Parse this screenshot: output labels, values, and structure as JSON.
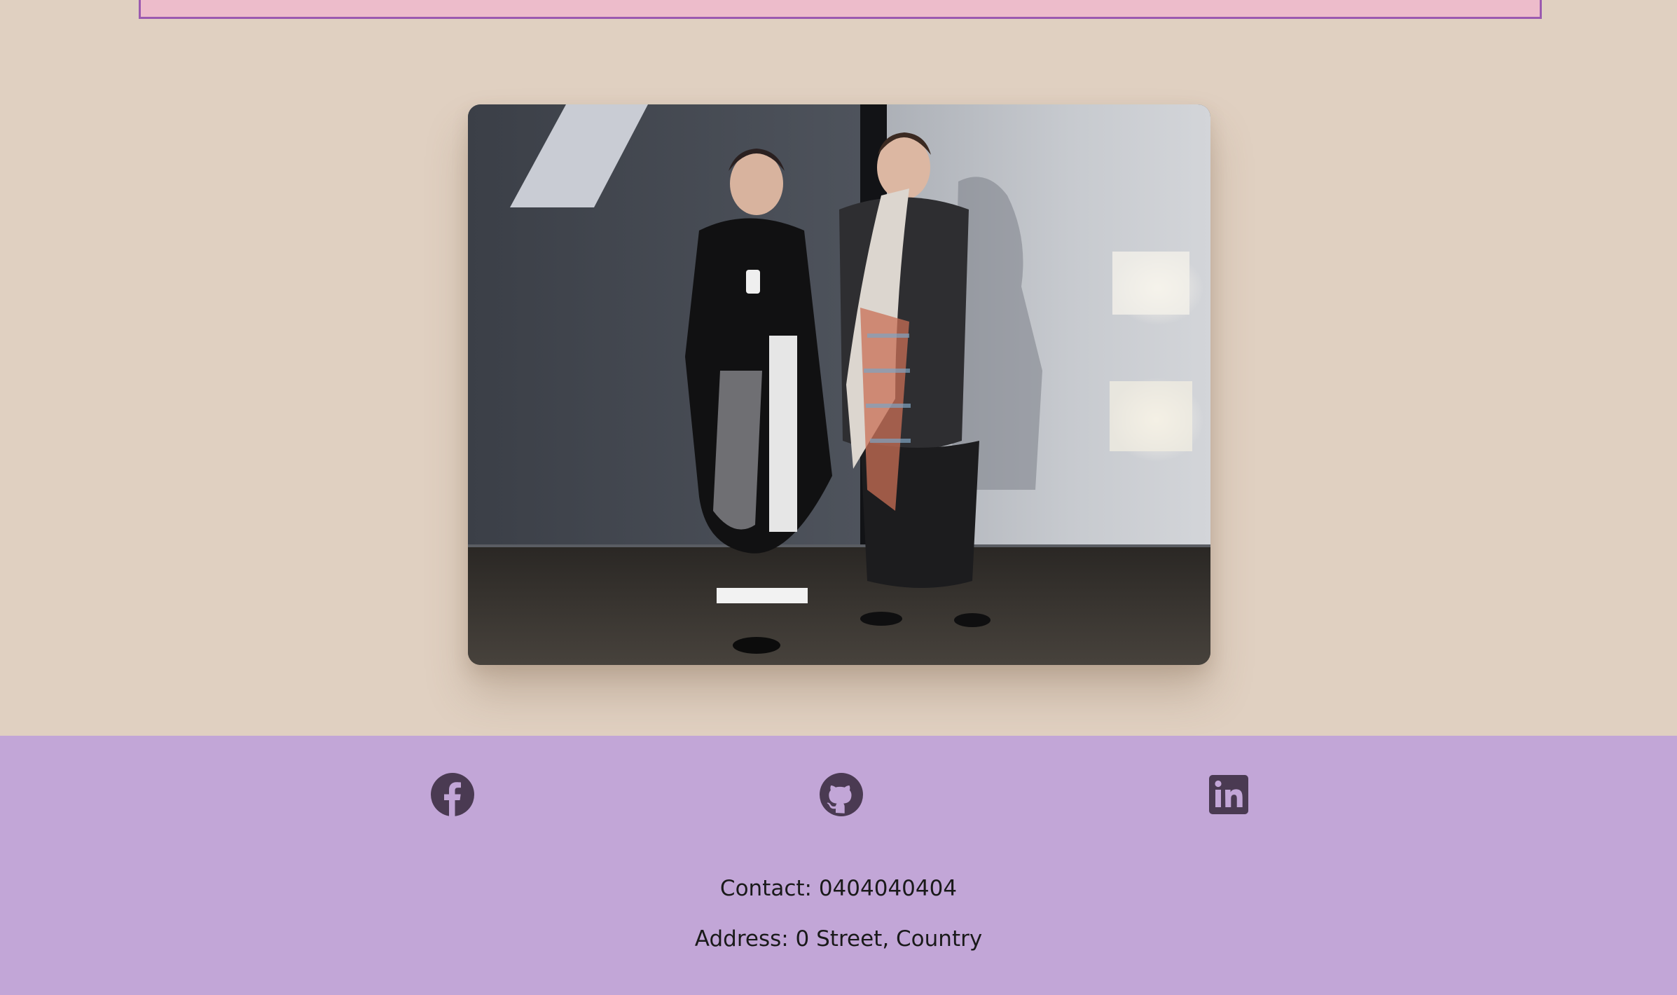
{
  "colors": {
    "page_background": "#e0d0c1",
    "banner_background": "#edbccb",
    "banner_border": "#9b5ab0",
    "footer_background": "#c2a6d7",
    "icon_color": "#4a3a52",
    "text_color": "#1a1a1a"
  },
  "photo": {
    "alt": "Two women standing against a wall in winter coats"
  },
  "footer": {
    "social": [
      {
        "name": "facebook",
        "icon": "facebook-icon"
      },
      {
        "name": "github",
        "icon": "github-icon"
      },
      {
        "name": "linkedin",
        "icon": "linkedin-icon"
      }
    ],
    "contact": "Contact: 0404040404",
    "address": "Address: 0 Street, Country"
  }
}
